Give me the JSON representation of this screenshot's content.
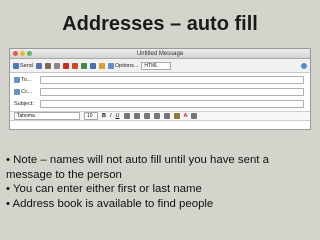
{
  "slide": {
    "title": "Addresses – auto fill",
    "bullets": [
      "Note – names will not auto fill until you have sent a message to the person",
      "You can enter either first or last name",
      "Address book is available to find people"
    ]
  },
  "window": {
    "title": "Untitled Message",
    "lights": [
      "#e85a4f",
      "#e6b93a",
      "#5cb85c"
    ],
    "toolbar": {
      "send_label": "Send",
      "options_label": "Options...",
      "format_value": "HTML"
    },
    "fields": [
      {
        "label": "To...",
        "value": ""
      },
      {
        "label": "Cc...",
        "value": ""
      },
      {
        "label": "Subject:",
        "value": ""
      }
    ],
    "format_bar": {
      "font": "Tahoma",
      "size": "10",
      "bold": "B",
      "italic": "I",
      "underline": "U",
      "font_color": "A"
    }
  }
}
